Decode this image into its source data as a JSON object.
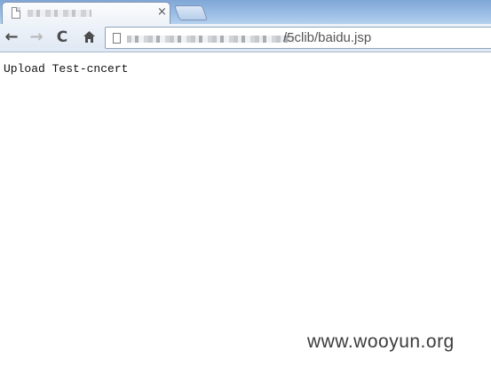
{
  "tab": {
    "close_glyph": "×",
    "favicon": "page-icon"
  },
  "toolbar": {
    "back_glyph": "←",
    "forward_glyph": "→",
    "reload_glyph": "C",
    "home_icon": "home-icon"
  },
  "omnibox": {
    "url_visible_part": "/5clib/baidu.jsp"
  },
  "page": {
    "body_text": "Upload Test-cncert"
  },
  "watermark": {
    "text": "www.wooyun.org"
  }
}
